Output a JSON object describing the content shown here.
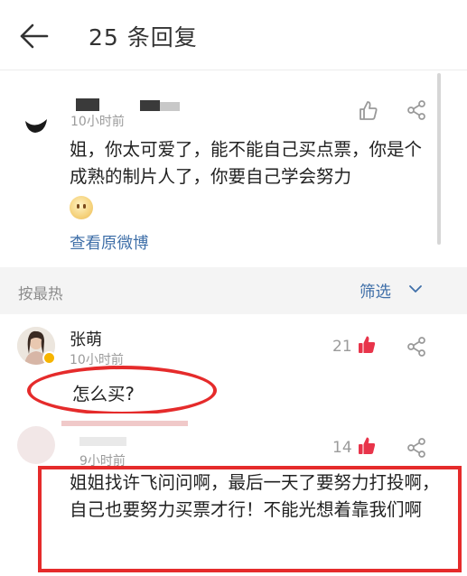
{
  "header": {
    "back_icon": "arrow-left-icon",
    "title": "25 条回复"
  },
  "original_post": {
    "time": "10小时前",
    "text": "姐，你太可爱了，能不能自己买点票，你是个成熟的制片人了，你要自己学会努力",
    "emoji": "blushing-face-emoji",
    "view_link": "查看原微博",
    "like_icon": "thumbs-up-outline-icon",
    "share_icon": "share-icon"
  },
  "sort_bar": {
    "label": "按最热",
    "filter_label": "筛选",
    "filter_icon": "chevron-down-icon"
  },
  "comments": [
    {
      "name": "张萌",
      "verified_badge": "verified-badge-icon",
      "time": "10小时前",
      "likes": "21",
      "text": "怎么买?",
      "annotation": "red oval around comment text"
    },
    {
      "name": "",
      "time": "9小时前",
      "likes": "14",
      "text": "姐姐找许飞问问啊，最后一天了要努力打投啊，自己也要努力买票才行！不能光想着靠我们啊",
      "annotation": "red rectangle around comment text"
    }
  ],
  "colors": {
    "link_blue": "#3f6fa8",
    "like_red": "#e8344a",
    "annotation_red": "#e52b2b",
    "meta_gray": "#9b9b9b"
  }
}
